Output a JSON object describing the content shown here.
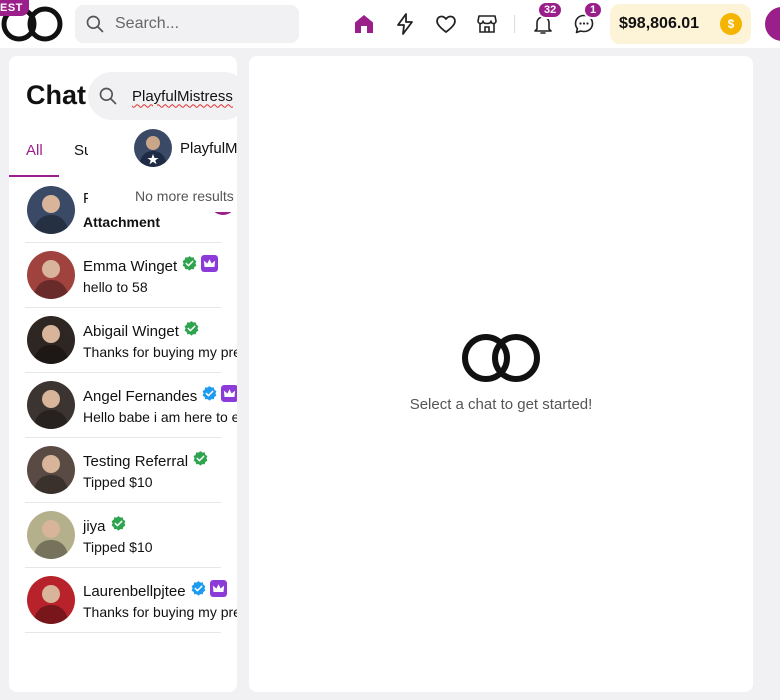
{
  "header": {
    "env_badge": "EST",
    "search_placeholder": "Search...",
    "nav": [
      {
        "name": "home-icon",
        "active": true
      },
      {
        "name": "lightning-icon",
        "active": false
      },
      {
        "name": "heart-icon",
        "active": false
      },
      {
        "name": "store-icon",
        "active": false
      },
      {
        "name": "bell-icon",
        "active": false
      },
      {
        "name": "messages-icon",
        "active": false
      }
    ],
    "notifications_count": "32",
    "messages_count": "1",
    "wallet_balance": "$98,806.01",
    "accent_color": "#9b1f8a"
  },
  "chat_panel": {
    "title": "Chat",
    "tabs": [
      {
        "label": "All",
        "active": true
      },
      {
        "label": "Subscri",
        "active": false
      }
    ],
    "search": {
      "value": "PlayfulMistress",
      "result_name": "PlayfulM",
      "no_more_text": "No more results"
    },
    "chats": [
      {
        "name": "Playfu",
        "preview": "Attachment",
        "preview_bold": true,
        "verified": "",
        "crown": false,
        "avatar_color": "#3a4a66"
      },
      {
        "name": "Emma Winget",
        "preview": "hello to 58",
        "preview_bold": false,
        "verified": "green",
        "crown": true,
        "avatar_color": "#a0433f"
      },
      {
        "name": "Abigail Winget",
        "preview": "Thanks for buying my pren",
        "preview_bold": false,
        "verified": "green",
        "crown": false,
        "avatar_color": "#2d2623"
      },
      {
        "name": "Angel Fernandes",
        "preview": "Hello babe i am here to en",
        "preview_bold": false,
        "verified": "blue",
        "crown": true,
        "avatar_color": "#3c3431"
      },
      {
        "name": "Testing Referral",
        "preview": "Tipped $10",
        "preview_bold": false,
        "verified": "green",
        "crown": false,
        "avatar_color": "#5a4a44"
      },
      {
        "name": "jiya",
        "preview": "Tipped $10",
        "preview_bold": false,
        "verified": "green",
        "crown": false,
        "avatar_color": "#b5b08c"
      },
      {
        "name": "Laurenbellpjtee",
        "preview": "Thanks for buying my pren",
        "preview_bold": false,
        "verified": "blue",
        "crown": true,
        "avatar_color": "#b8232b"
      }
    ]
  },
  "main": {
    "empty_text": "Select a chat to get started!"
  }
}
